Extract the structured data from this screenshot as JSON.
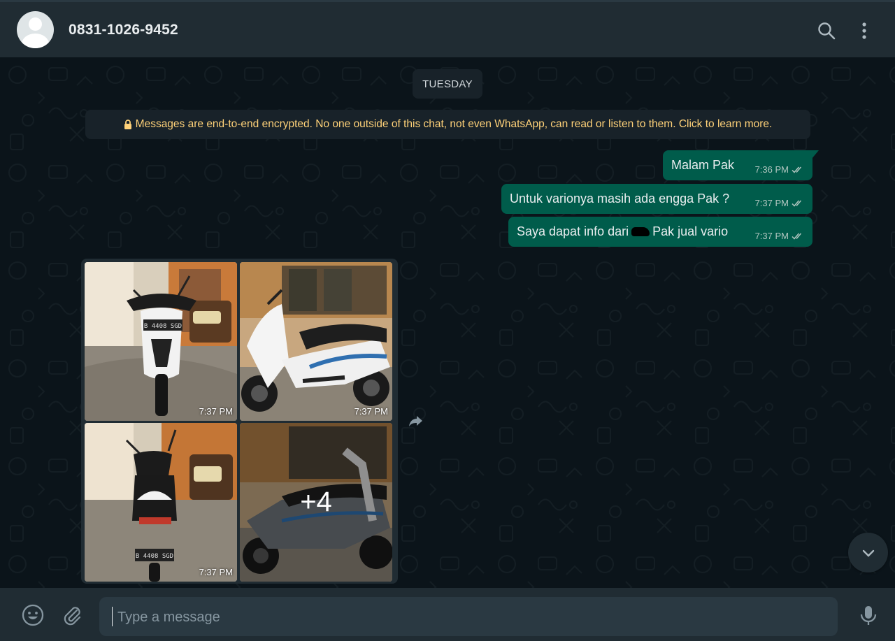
{
  "header": {
    "contact_name": "0831-1026-9452",
    "icons": [
      "avatar",
      "search-icon",
      "menu-icon"
    ]
  },
  "chat": {
    "date_label": "TUESDAY",
    "encryption_notice": "Messages are end-to-end encrypted. No one outside of this chat, not even WhatsApp, can read or listen to them. Click to learn more.",
    "messages": [
      {
        "text": "Malam Pak",
        "time": "7:36 PM",
        "status": "read"
      },
      {
        "text": "Untuk varionya masih ada engga Pak ?",
        "time": "7:37 PM",
        "status": "read"
      },
      {
        "text_before": "Saya dapat info dari",
        "text_after": "Pak jual vario",
        "time": "7:37 PM",
        "status": "read"
      }
    ],
    "album": {
      "photos": [
        {
          "time": "7:37 PM"
        },
        {
          "time": "7:37 PM"
        },
        {
          "time": "7:37 PM"
        }
      ],
      "more_count": "+4"
    }
  },
  "composer": {
    "placeholder": "Type a message",
    "value": ""
  },
  "colors": {
    "outgoing_bubble": "#005c4b",
    "header_bg": "#202c33",
    "chat_bg": "#0b141a",
    "notice_text": "#ffd279",
    "read_ticks": "#b1c6c0"
  }
}
